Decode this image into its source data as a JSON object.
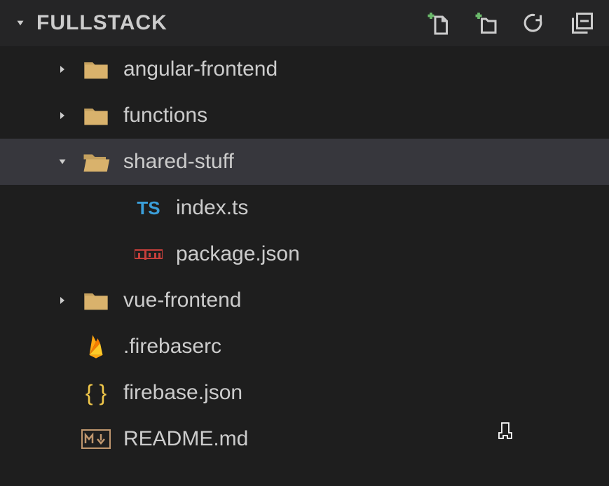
{
  "header": {
    "title": "FULLSTACK"
  },
  "tree": {
    "items": [
      {
        "label": "angular-frontend",
        "type": "folder",
        "expanded": false,
        "depth": 1
      },
      {
        "label": "functions",
        "type": "folder",
        "expanded": false,
        "depth": 1
      },
      {
        "label": "shared-stuff",
        "type": "folder",
        "expanded": true,
        "depth": 1,
        "selected": true
      },
      {
        "label": "index.ts",
        "type": "file-ts",
        "depth": 2
      },
      {
        "label": "package.json",
        "type": "file-npm",
        "depth": 2
      },
      {
        "label": "vue-frontend",
        "type": "folder",
        "expanded": false,
        "depth": 1
      },
      {
        "label": ".firebaserc",
        "type": "file-firebase",
        "depth": 1
      },
      {
        "label": "firebase.json",
        "type": "file-json",
        "depth": 1
      },
      {
        "label": "README.md",
        "type": "file-md",
        "depth": 1
      }
    ]
  },
  "icons": {
    "ts": "TS",
    "json_braces": "{ }",
    "md": "M↓"
  }
}
